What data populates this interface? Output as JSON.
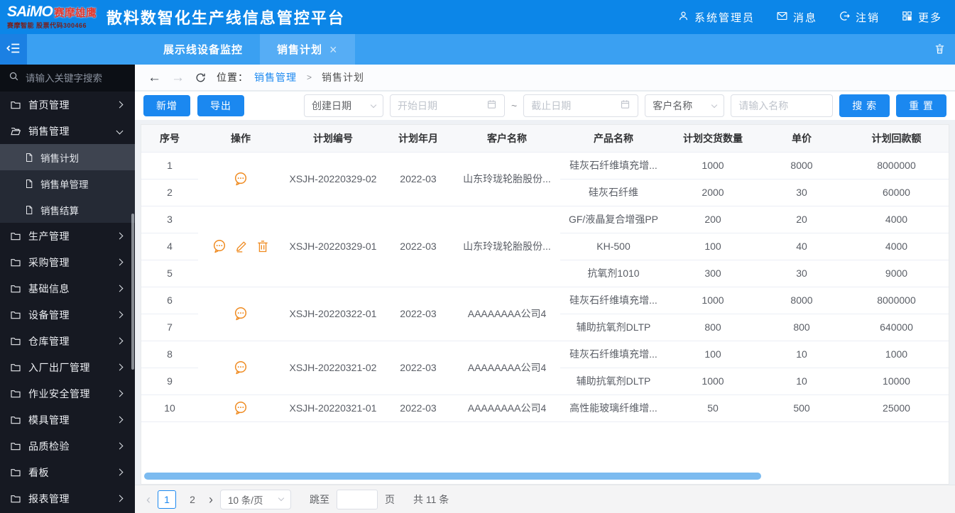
{
  "header": {
    "logo": {
      "brand": "SAiMO",
      "brand_suffix": "赛摩雄鹰",
      "subtitle": "赛摩智能 股票代码300466"
    },
    "title": "散料数智化生产线信息管控平台",
    "menu": [
      {
        "icon": "user-icon",
        "label": "系统管理员"
      },
      {
        "icon": "mail-icon",
        "label": "消息"
      },
      {
        "icon": "logout-icon",
        "label": "注销"
      },
      {
        "icon": "grid-icon",
        "label": "更多"
      }
    ]
  },
  "tabs": {
    "items": [
      {
        "label": "展示线设备监控",
        "active": false,
        "closable": false
      },
      {
        "label": "销售计划",
        "active": true,
        "closable": true
      }
    ]
  },
  "sidebar": {
    "search_placeholder": "请输入关键字搜索",
    "menu": [
      {
        "label": "首页管理",
        "expanded": false
      },
      {
        "label": "销售管理",
        "expanded": true,
        "children": [
          {
            "label": "销售计划",
            "selected": true
          },
          {
            "label": "销售单管理",
            "selected": false
          },
          {
            "label": "销售结算",
            "selected": false
          }
        ]
      },
      {
        "label": "生产管理",
        "expanded": false
      },
      {
        "label": "采购管理",
        "expanded": false
      },
      {
        "label": "基础信息",
        "expanded": false
      },
      {
        "label": "设备管理",
        "expanded": false
      },
      {
        "label": "仓库管理",
        "expanded": false
      },
      {
        "label": "入厂出厂管理",
        "expanded": false
      },
      {
        "label": "作业安全管理",
        "expanded": false
      },
      {
        "label": "模具管理",
        "expanded": false
      },
      {
        "label": "品质检验",
        "expanded": false
      },
      {
        "label": "看板",
        "expanded": false
      },
      {
        "label": "报表管理",
        "expanded": false
      }
    ]
  },
  "breadcrumb": {
    "prefix": "位置：",
    "parent": "销售管理",
    "separator": ">",
    "current": "销售计划"
  },
  "toolbar": {
    "add_label": "新增",
    "export_label": "导出",
    "date_type_value": "创建日期",
    "start_date_placeholder": "开始日期",
    "range_separator": "~",
    "end_date_placeholder": "截止日期",
    "field_value": "客户名称",
    "name_placeholder": "请输入名称",
    "search_label": "搜 索",
    "reset_label": "重 置"
  },
  "table": {
    "columns": [
      "序号",
      "操作",
      "计划编号",
      "计划年月",
      "客户名称",
      "产品名称",
      "计划交货数量",
      "单价",
      "计划回款额"
    ],
    "groups": [
      {
        "plan_no": "XSJH-20220329-02",
        "plan_month": "2022-03",
        "customer": "山东玲珑轮胎股份...",
        "actions": [
          "comment"
        ],
        "items": [
          {
            "no": "1",
            "product": "硅灰石纤维填充增...",
            "qty": "1000",
            "price": "8000",
            "amount": "8000000"
          },
          {
            "no": "2",
            "product": "硅灰石纤维",
            "qty": "2000",
            "price": "30",
            "amount": "60000"
          }
        ]
      },
      {
        "plan_no": "XSJH-20220329-01",
        "plan_month": "2022-03",
        "customer": "山东玲珑轮胎股份...",
        "actions": [
          "comment",
          "edit",
          "delete"
        ],
        "items": [
          {
            "no": "3",
            "product": "GF/液晶复合增强PP",
            "qty": "200",
            "price": "20",
            "amount": "4000"
          },
          {
            "no": "4",
            "product": "KH-500",
            "qty": "100",
            "price": "40",
            "amount": "4000"
          },
          {
            "no": "5",
            "product": "抗氧剂1010",
            "qty": "300",
            "price": "30",
            "amount": "9000"
          }
        ]
      },
      {
        "plan_no": "XSJH-20220322-01",
        "plan_month": "2022-03",
        "customer": "AAAAAAAA公司4",
        "actions": [
          "comment"
        ],
        "items": [
          {
            "no": "6",
            "product": "硅灰石纤维填充增...",
            "qty": "1000",
            "price": "8000",
            "amount": "8000000"
          },
          {
            "no": "7",
            "product": "辅助抗氧剂DLTP",
            "qty": "800",
            "price": "800",
            "amount": "640000"
          }
        ]
      },
      {
        "plan_no": "XSJH-20220321-02",
        "plan_month": "2022-03",
        "customer": "AAAAAAAA公司4",
        "actions": [
          "comment"
        ],
        "items": [
          {
            "no": "8",
            "product": "硅灰石纤维填充增...",
            "qty": "100",
            "price": "10",
            "amount": "1000"
          },
          {
            "no": "9",
            "product": "辅助抗氧剂DLTP",
            "qty": "1000",
            "price": "10",
            "amount": "10000"
          }
        ]
      },
      {
        "plan_no": "XSJH-20220321-01",
        "plan_month": "2022-03",
        "customer": "AAAAAAAA公司4",
        "actions": [
          "comment"
        ],
        "items": [
          {
            "no": "10",
            "product": "高性能玻璃纤维增...",
            "qty": "50",
            "price": "500",
            "amount": "25000"
          }
        ]
      }
    ]
  },
  "pagination": {
    "prev": "‹",
    "next": "›",
    "pages": [
      "1",
      "2"
    ],
    "current": "1",
    "page_size_value": "10 条/页",
    "jump_label": "跳至",
    "page_label": "页",
    "total_label": "共 11 条"
  },
  "colors": {
    "header_blue": "#0c86e8",
    "tabbar_blue": "#3aa0f2",
    "accent_blue": "#1b88f0",
    "icon_orange": "#ef8a1f",
    "sidebar_dark": "#161922"
  }
}
